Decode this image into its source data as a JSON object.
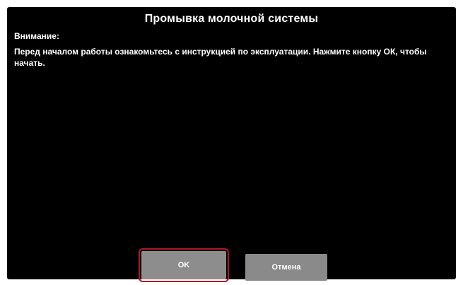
{
  "dialog": {
    "title": "Промывка молочной системы",
    "attention_label": "Внимание:",
    "message": "Перед началом работы ознакомьтесь с инструкцией по эксплуатации. Нажмите кнопку ОК, чтобы начать."
  },
  "buttons": {
    "ok_label": "OK",
    "cancel_label": "Отмена"
  },
  "colors": {
    "background": "#000000",
    "button": "#8a8a8a",
    "focus_outline": "#b0172a"
  }
}
